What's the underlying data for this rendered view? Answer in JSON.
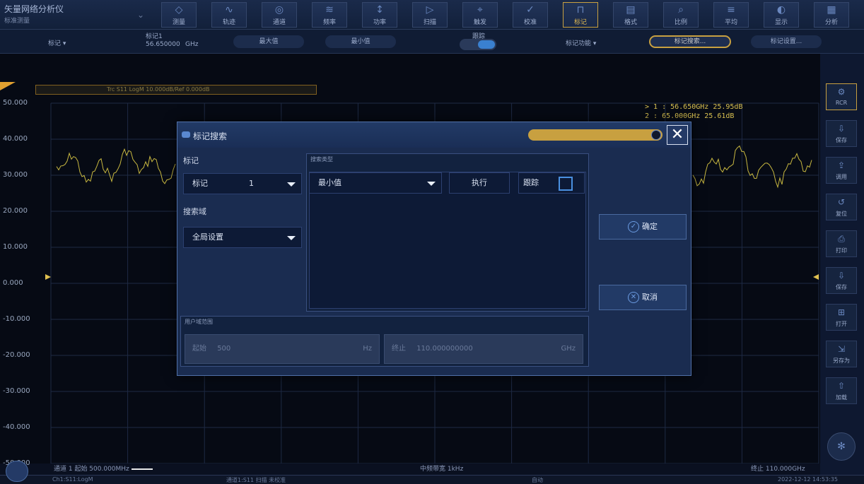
{
  "app": {
    "title": "矢量网络分析仪",
    "subtitle": "标准测量"
  },
  "toolbar": {
    "collapse_icon": "chevron-down",
    "buttons": [
      {
        "label": "测量",
        "icon": "measure"
      },
      {
        "label": "轨迹",
        "icon": "trace"
      },
      {
        "label": "通道",
        "icon": "channel"
      },
      {
        "label": "频率",
        "icon": "frequency"
      },
      {
        "label": "功率",
        "icon": "power"
      },
      {
        "label": "扫描",
        "icon": "sweep"
      },
      {
        "label": "触发",
        "icon": "trigger"
      },
      {
        "label": "校准",
        "icon": "calibration"
      },
      {
        "label": "标记",
        "icon": "marker",
        "active": true
      },
      {
        "label": "格式",
        "icon": "format"
      },
      {
        "label": "比例",
        "icon": "scale"
      },
      {
        "label": "平均",
        "icon": "average"
      },
      {
        "label": "显示",
        "icon": "display"
      },
      {
        "label": "分析",
        "icon": "analysis"
      }
    ]
  },
  "subbar": {
    "marker_menu": "标记",
    "marker_field_label": "标记1",
    "marker_field_value": "56.650000",
    "marker_unit": "GHz",
    "max_button": "最大值",
    "min_button": "最小值",
    "toggle_label": "跟踪",
    "marker_func": "标记功能",
    "marker_search": "标记搜索...",
    "marker_settings": "标记设置..."
  },
  "plot": {
    "trace_label": "Trc S11 LogM 10.000dB/Ref 0.000dB",
    "y_ticks": [
      "50.000",
      "40.000",
      "30.000",
      "20.000",
      "10.000",
      "0.000",
      "-10.000",
      "-20.000",
      "-30.000",
      "-40.000",
      "-50.000"
    ],
    "marker_readouts": [
      "> 1  : 56.650GHz  25.95dB",
      "  2  : 65.000GHz  25.61dB"
    ],
    "bottom_left": "通道 1 起始 500.000MHz",
    "bottom_center": "中频带宽 1kHz",
    "bottom_right": "终止 110.000GHz",
    "trace_color": "#c8b840"
  },
  "status_bar": {
    "left": "Ch1:S11:LogM",
    "middle": "通道1:S11 扫描 未校准",
    "center": "自动",
    "right": "2022-12-12 14:53:35"
  },
  "rightbar": {
    "buttons": [
      {
        "label": "RCR",
        "icon": "rcr",
        "active": true
      },
      {
        "label": "保存",
        "icon": "save"
      },
      {
        "label": "调用",
        "icon": "recall"
      },
      {
        "label": "复位",
        "icon": "reset"
      },
      {
        "label": "打印",
        "icon": "print"
      },
      {
        "label": "保存",
        "icon": "save-2"
      },
      {
        "label": "打开",
        "icon": "open"
      },
      {
        "label": "另存为",
        "icon": "save-as"
      },
      {
        "label": "加载",
        "icon": "load"
      }
    ]
  },
  "dialog": {
    "title": "标记搜索",
    "marker_section": "标记",
    "marker_dropdown": "标记",
    "marker_number": "1",
    "search_domain": "搜索域",
    "domain_dropdown": "全局设置",
    "search_type_label": "搜索类型",
    "search_type_value": "最小值",
    "execute_button": "执行",
    "track_label": "跟踪",
    "ok_button": "确定",
    "cancel_button": "取消",
    "user_range_label": "用户域范围",
    "start_label": "起始",
    "start_value": "500",
    "start_unit": "Hz",
    "stop_label": "终止",
    "stop_value": "110.000000000",
    "stop_unit": "GHz"
  }
}
